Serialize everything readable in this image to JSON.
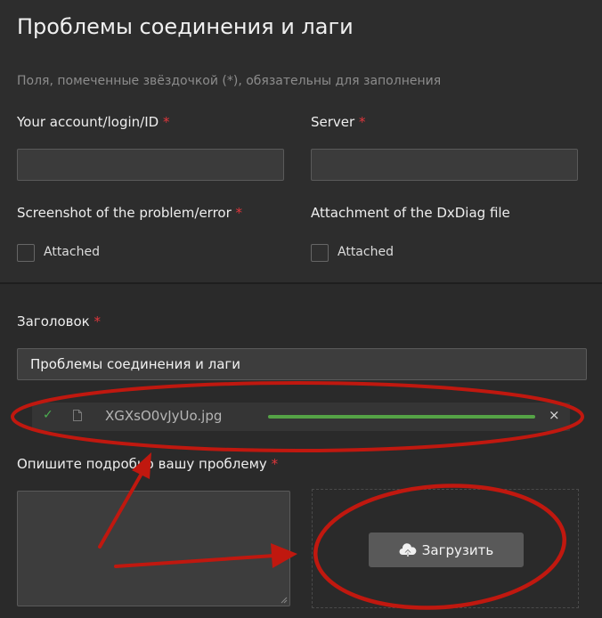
{
  "form": {
    "title": "Проблемы соединения и лаги",
    "hint": "Поля, помеченные звёздочкой (*), обязательны для заполнения",
    "required_mark": "*",
    "account_label": "Your account/login/ID",
    "server_label": "Server",
    "screenshot_label": "Screenshot of the problem/error",
    "dxdiag_label": "Attachment of the DxDiag file",
    "attached_label": "Attached",
    "heading_label": "Заголовок",
    "heading_value": "Проблемы соединения и лаги",
    "attachment": {
      "file_name": "XGXsO0vJyUo.jpg",
      "progress": 1.0,
      "close_glyph": "×",
      "check_glyph": "✓"
    },
    "description_label": "Опишите подробно вашу проблему",
    "upload_label": "Загрузить"
  },
  "annotations": {
    "color": "#c0180f"
  },
  "colors": {
    "accent_required": "#e0363c",
    "progress": "#55a346",
    "check": "#4caf50"
  },
  "icons": {
    "attachment_status": "check-icon",
    "attachment_file": "file-icon",
    "attachment_remove": "close-icon",
    "upload": "cloud-upload-icon"
  }
}
